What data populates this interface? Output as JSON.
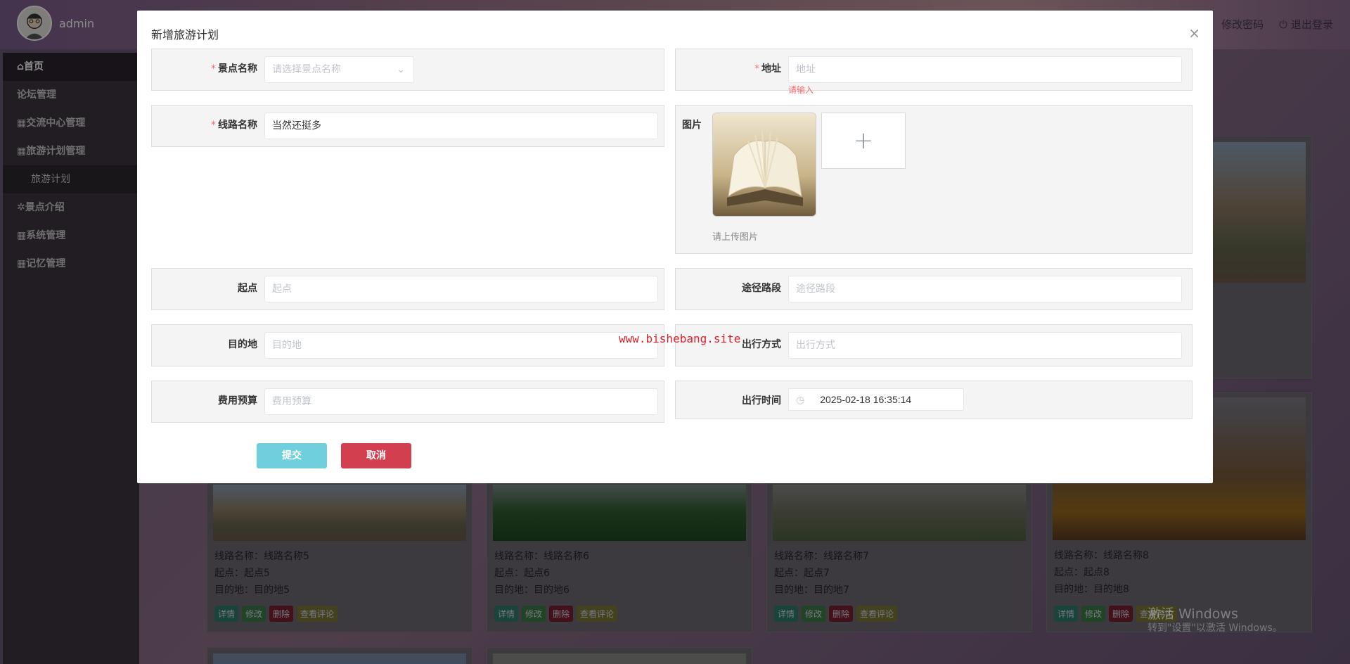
{
  "header": {
    "admin_name": "admin",
    "change_password": "修改密码",
    "logout": "退出登录"
  },
  "sidebar": {
    "items": [
      {
        "label": "首页",
        "icon": "home-icon"
      },
      {
        "label": "论坛管理"
      },
      {
        "label": "交流中心管理"
      },
      {
        "label": "旅游计划管理"
      },
      {
        "label": "旅游计划"
      },
      {
        "label": "景点介绍"
      },
      {
        "label": "系统管理"
      },
      {
        "label": "记忆管理"
      }
    ]
  },
  "cards": [
    {
      "route": "线路名称：线路名称5",
      "start": "起点：起点5",
      "dest": "目的地：目的地5"
    },
    {
      "route": "线路名称：线路名称6",
      "start": "起点：起点6",
      "dest": "目的地：目的地6"
    },
    {
      "route": "线路名称：线路名称7",
      "start": "起点：起点7",
      "dest": "目的地：目的地7"
    },
    {
      "route": "线路名称：线路名称8",
      "start": "起点：起点8",
      "dest": "目的地：目的地8"
    }
  ],
  "card_buttons": {
    "detail": "详情",
    "edit": "修改",
    "delete": "删除",
    "comments": "查看评论"
  },
  "os_watermark": {
    "line1": "激活 Windows",
    "line2": "转到\"设置\"以激活 Windows。"
  },
  "dialog": {
    "title": "新增旅游计划",
    "close": "×",
    "fields": {
      "scenic_name": {
        "label": "景点名称",
        "required": "*",
        "placeholder": "请选择景点名称"
      },
      "address": {
        "label": "地址",
        "required": "*",
        "placeholder": "地址",
        "error": "请输入"
      },
      "route_name": {
        "label": "线路名称",
        "required": "*",
        "value": "当然还挺多"
      },
      "image": {
        "label": "图片",
        "hint": "请上传图片"
      },
      "start": {
        "label": "起点",
        "placeholder": "起点"
      },
      "waypoints": {
        "label": "途径路段",
        "placeholder": "途径路段"
      },
      "destination": {
        "label": "目的地",
        "placeholder": "目的地"
      },
      "travel_mode": {
        "label": "出行方式",
        "placeholder": "出行方式"
      },
      "budget": {
        "label": "费用预算",
        "placeholder": "费用预算"
      },
      "departure_time": {
        "label": "出行时间",
        "value": "2025-02-18 16:35:14"
      }
    },
    "submit": "提交",
    "cancel": "取消"
  },
  "site_watermark": "www.bishebang.site"
}
